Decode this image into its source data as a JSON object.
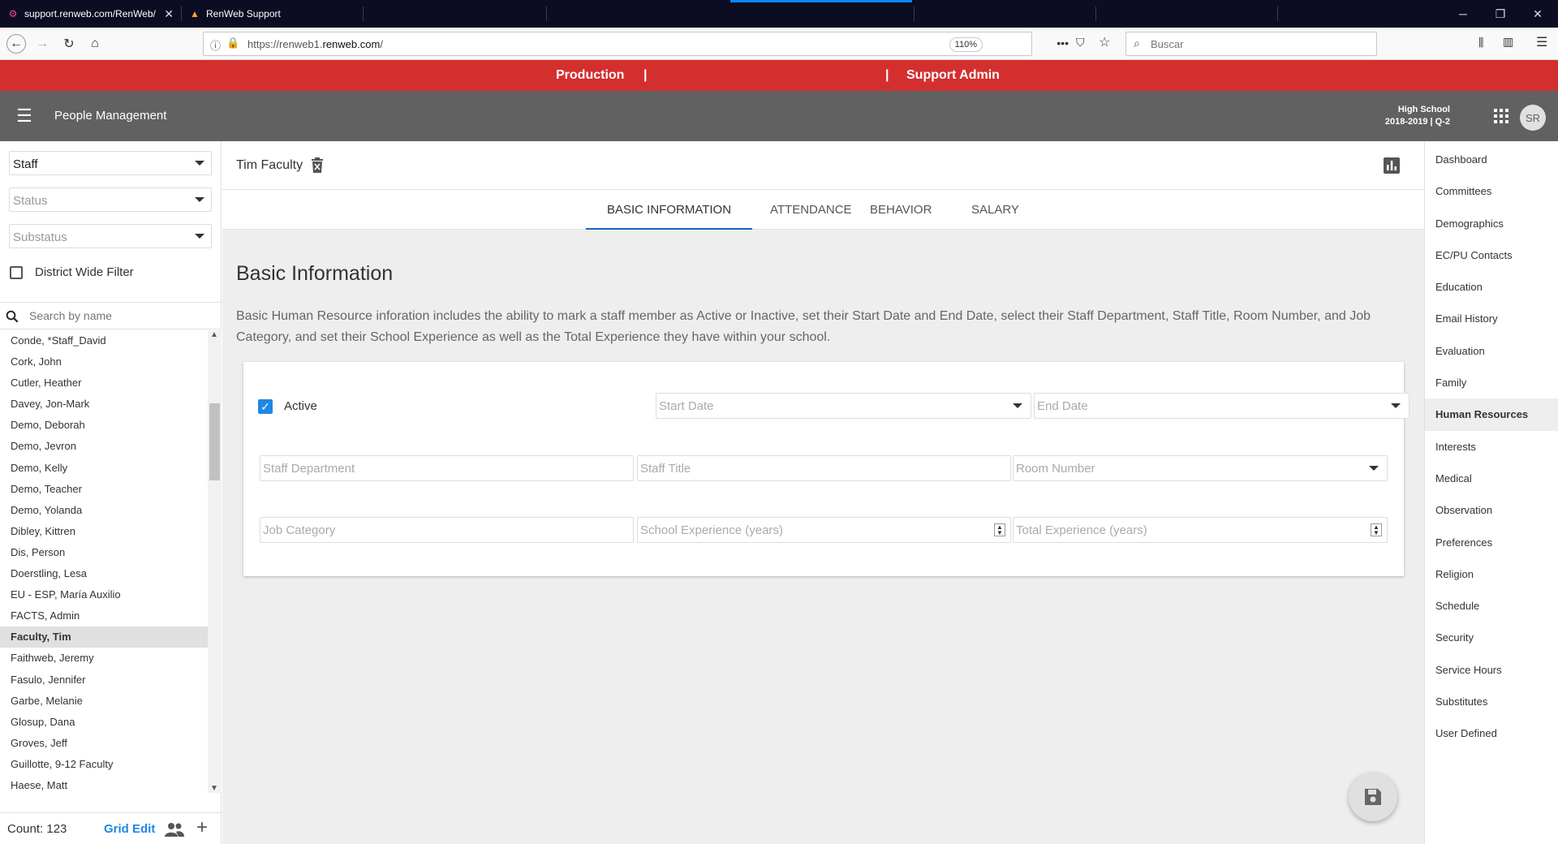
{
  "browser": {
    "tabs": [
      {
        "title": "support.renweb.com/RenWeb/"
      },
      {
        "title": "RenWeb Support"
      }
    ],
    "url_prefix": "https://renweb1.",
    "url_domain": "renweb.com",
    "url_suffix": "/",
    "zoom": "110%",
    "search_placeholder": "Buscar"
  },
  "env_bar": {
    "left": "Production",
    "sep1": "|",
    "sep2": "|",
    "right": "Support Admin"
  },
  "header": {
    "title": "People Management",
    "school": "High School",
    "term": "2018-2019 | Q-2",
    "avatar_initials": "SR"
  },
  "filters": {
    "type": "Staff",
    "status_placeholder": "Status",
    "substatus_placeholder": "Substatus",
    "district_wide_label": "District Wide Filter",
    "search_placeholder": "Search by name"
  },
  "people": [
    {
      "name": "Conde, *Staff_David"
    },
    {
      "name": "Cork, John"
    },
    {
      "name": "Cutler, Heather"
    },
    {
      "name": "Davey, Jon-Mark"
    },
    {
      "name": "Demo, Deborah"
    },
    {
      "name": "Demo, Jevron"
    },
    {
      "name": "Demo, Kelly"
    },
    {
      "name": "Demo, Teacher"
    },
    {
      "name": "Demo, Yolanda"
    },
    {
      "name": "Dibley, Kittren"
    },
    {
      "name": "Dis, Person"
    },
    {
      "name": "Doerstling, Lesa"
    },
    {
      "name": "EU - ESP, María Auxilio"
    },
    {
      "name": "FACTS, Admin"
    },
    {
      "name": "Faculty, Tim",
      "selected": true
    },
    {
      "name": "Faithweb, Jeremy"
    },
    {
      "name": "Fasulo, Jennifer"
    },
    {
      "name": "Garbe, Melanie"
    },
    {
      "name": "Glosup, Dana"
    },
    {
      "name": "Groves, Jeff"
    },
    {
      "name": "Guillotte, 9-12 Faculty"
    },
    {
      "name": "Haese, Matt"
    }
  ],
  "list_footer": {
    "count": "Count: 123",
    "grid_edit": "Grid Edit"
  },
  "person": {
    "name": "Tim Faculty"
  },
  "tabs": [
    {
      "label": "BASIC INFORMATION",
      "active": true
    },
    {
      "label": "ATTENDANCE"
    },
    {
      "label": "BEHAVIOR"
    },
    {
      "label": "SALARY"
    }
  ],
  "section": {
    "title": "Basic Information",
    "description": "Basic Human Resource inforation includes the ability to mark a staff member as Active or Inactive, set their Start Date and End Date, select their Staff Department, Staff Title, Room Number, and Job Category, and set their School Experience as well as the Total Experience they have within your school."
  },
  "form": {
    "active_label": "Active",
    "active_checked": true,
    "start_date": "Start Date",
    "end_date": "End Date",
    "staff_department": "Staff Department",
    "staff_title": "Staff Title",
    "room_number": "Room Number",
    "job_category": "Job Category",
    "school_experience": "School Experience (years)",
    "total_experience": "Total Experience (years)"
  },
  "right_nav": [
    {
      "label": "Dashboard"
    },
    {
      "label": "Committees"
    },
    {
      "label": "Demographics"
    },
    {
      "label": "EC/PU Contacts"
    },
    {
      "label": "Education"
    },
    {
      "label": "Email History"
    },
    {
      "label": "Evaluation"
    },
    {
      "label": "Family"
    },
    {
      "label": "Human Resources",
      "selected": true
    },
    {
      "label": "Interests"
    },
    {
      "label": "Medical"
    },
    {
      "label": "Observation"
    },
    {
      "label": "Preferences"
    },
    {
      "label": "Religion"
    },
    {
      "label": "Schedule"
    },
    {
      "label": "Security"
    },
    {
      "label": "Service Hours"
    },
    {
      "label": "Substitutes"
    },
    {
      "label": "User Defined"
    }
  ],
  "colors": {
    "env_bar": "#d32f2f",
    "header": "#616161",
    "accent": "#1e88e5"
  }
}
